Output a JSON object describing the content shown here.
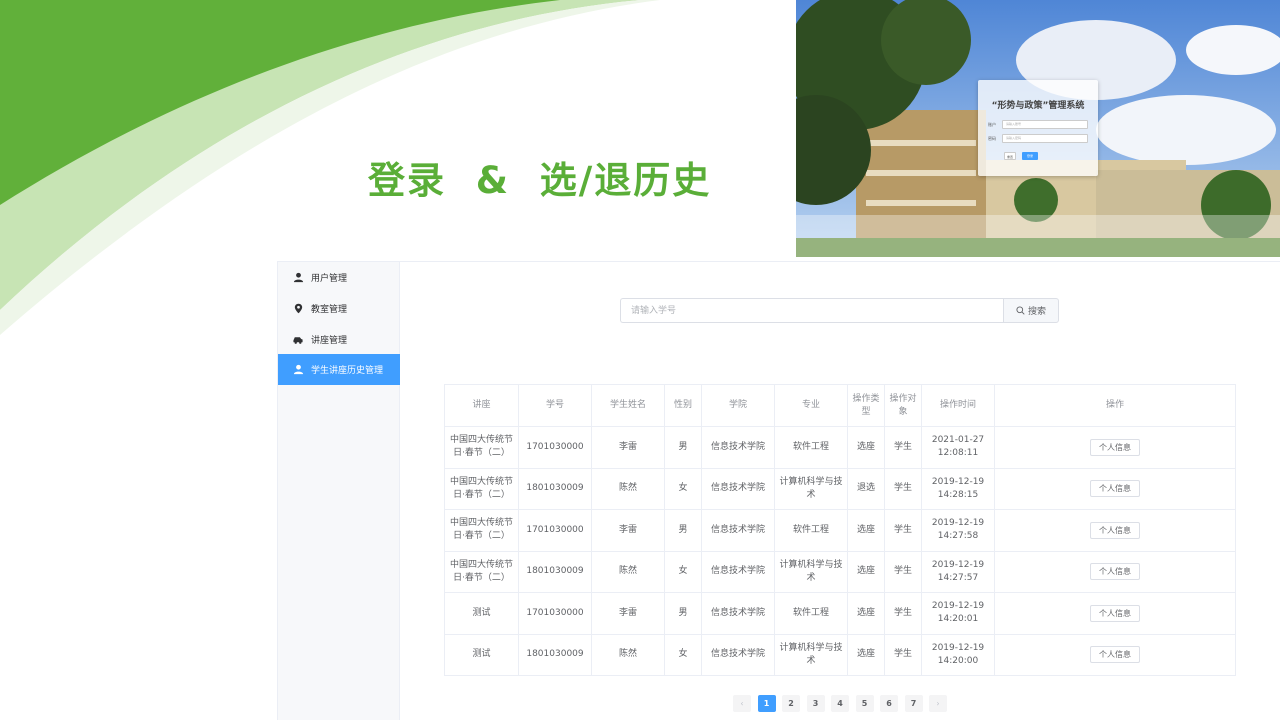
{
  "slide": {
    "title": "登录  &  选/退历史"
  },
  "login": {
    "title": "“形势与政策”管理系统",
    "user_label": "账户",
    "user_placeholder": "请输入账号",
    "pass_label": "密码",
    "pass_placeholder": "请输入密码",
    "reset_label": "重置",
    "submit_label": "登录"
  },
  "sidebar": {
    "items": [
      {
        "label": "用户管理",
        "icon": "user-icon",
        "active": false
      },
      {
        "label": "教室管理",
        "icon": "location-icon",
        "active": false
      },
      {
        "label": "讲座管理",
        "icon": "car-icon",
        "active": false
      },
      {
        "label": "学生讲座历史管理",
        "icon": "user-icon",
        "active": true
      }
    ]
  },
  "search": {
    "placeholder": "请输入学号",
    "button_label": "搜索"
  },
  "table": {
    "headers": [
      "讲座",
      "学号",
      "学生姓名",
      "性别",
      "学院",
      "专业",
      "操作类型",
      "操作对象",
      "操作时间",
      "操作"
    ],
    "action_label": "个人信息",
    "rows": [
      {
        "lecture": "中国四大传统节日·春节（二）",
        "id": "1701030000",
        "name": "李雷",
        "gender": "男",
        "college": "信息技术学院",
        "major": "软件工程",
        "op_type": "选座",
        "op_target": "学生",
        "time": "2021-01-27 12:08:11"
      },
      {
        "lecture": "中国四大传统节日·春节（二）",
        "id": "1801030009",
        "name": "陈然",
        "gender": "女",
        "college": "信息技术学院",
        "major": "计算机科学与技术",
        "op_type": "退选",
        "op_target": "学生",
        "time": "2019-12-19 14:28:15"
      },
      {
        "lecture": "中国四大传统节日·春节（二）",
        "id": "1701030000",
        "name": "李雷",
        "gender": "男",
        "college": "信息技术学院",
        "major": "软件工程",
        "op_type": "选座",
        "op_target": "学生",
        "time": "2019-12-19 14:27:58"
      },
      {
        "lecture": "中国四大传统节日·春节（二）",
        "id": "1801030009",
        "name": "陈然",
        "gender": "女",
        "college": "信息技术学院",
        "major": "计算机科学与技术",
        "op_type": "选座",
        "op_target": "学生",
        "time": "2019-12-19 14:27:57"
      },
      {
        "lecture": "测试",
        "id": "1701030000",
        "name": "李雷",
        "gender": "男",
        "college": "信息技术学院",
        "major": "软件工程",
        "op_type": "选座",
        "op_target": "学生",
        "time": "2019-12-19 14:20:01"
      },
      {
        "lecture": "测试",
        "id": "1801030009",
        "name": "陈然",
        "gender": "女",
        "college": "信息技术学院",
        "major": "计算机科学与技术",
        "op_type": "选座",
        "op_target": "学生",
        "time": "2019-12-19 14:20:00"
      }
    ]
  },
  "pagination": {
    "prev": "‹",
    "next": "›",
    "pages": [
      "1",
      "2",
      "3",
      "4",
      "5",
      "6",
      "7"
    ],
    "current": "1"
  },
  "colors": {
    "accent": "#409eff",
    "brand_green": "#5aae38"
  }
}
